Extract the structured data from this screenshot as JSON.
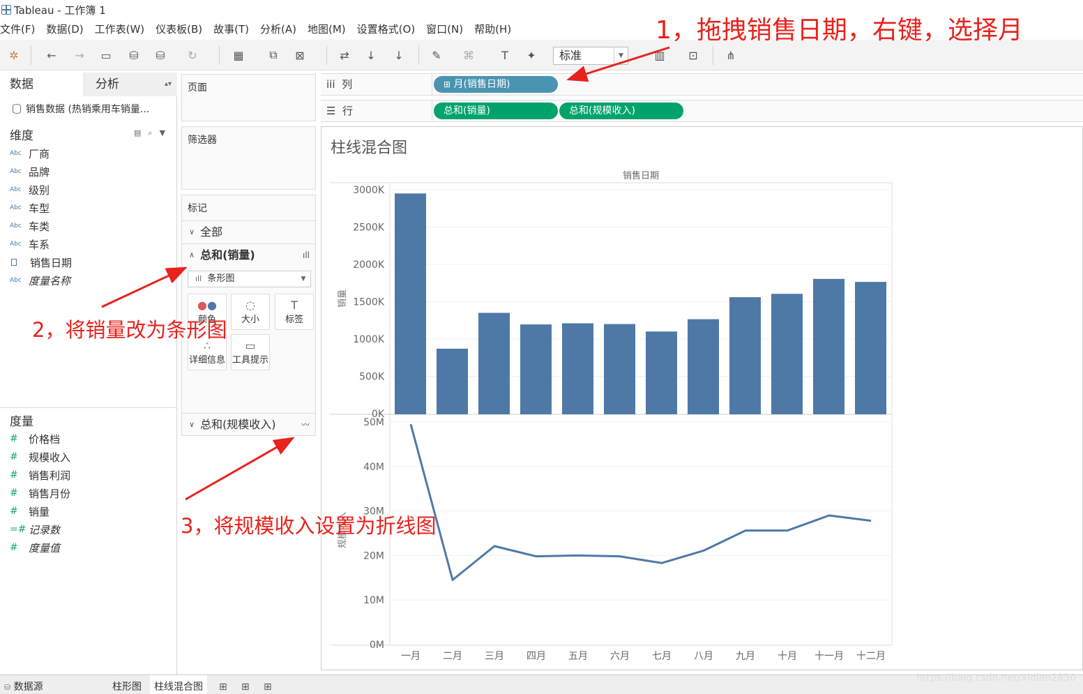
{
  "window": {
    "title": "Tableau - 工作簿 1"
  },
  "menu": [
    "文件(F)",
    "数据(D)",
    "工作表(W)",
    "仪表板(B)",
    "故事(T)",
    "分析(A)",
    "地图(M)",
    "设置格式(O)",
    "窗口(N)",
    "帮助(H)"
  ],
  "toolbar": {
    "fit_select": "标准"
  },
  "left_pane": {
    "tab_data": "数据",
    "tab_analysis": "分析",
    "datasource": "销售数据 (热销乘用车销量...",
    "dimensions_title": "维度",
    "dimensions": [
      {
        "label": "厂商",
        "icon": "Abc"
      },
      {
        "label": "品牌",
        "icon": "Abc"
      },
      {
        "label": "级别",
        "icon": "Abc"
      },
      {
        "label": "车型",
        "icon": "Abc"
      },
      {
        "label": "车类",
        "icon": "Abc"
      },
      {
        "label": "车系",
        "icon": "Abc"
      },
      {
        "label": "销售日期",
        "icon": "calendar-icon"
      },
      {
        "label": "度量名称",
        "icon": "Abc"
      }
    ],
    "measures_title": "度量",
    "measures": [
      {
        "label": "价格档",
        "icon": "#"
      },
      {
        "label": "规模收入",
        "icon": "#"
      },
      {
        "label": "销售利润",
        "icon": "#"
      },
      {
        "label": "销售月份",
        "icon": "#"
      },
      {
        "label": "销量",
        "icon": "#"
      },
      {
        "label": "记录数",
        "icon": "=#"
      },
      {
        "label": "度量值",
        "icon": "#"
      }
    ]
  },
  "cards": {
    "pages": "页面",
    "filters": "筛选器",
    "marks": "标记",
    "all": "全部",
    "sales_card": "总和(销量)",
    "mark_type": "条形图",
    "color": "颜色",
    "size": "大小",
    "label": "标签",
    "detail": "详细信息",
    "tooltip": "工具提示",
    "revenue_card": "总和(规模收入)"
  },
  "shelves": {
    "columns_label": "列",
    "rows_label": "行",
    "columns_pill": "月(销售日期)",
    "rows_pills": [
      "总和(销量)",
      "总和(规模收入)"
    ]
  },
  "bottom": {
    "datasource_tab": "数据源",
    "sheets": [
      "柱形图",
      "柱线混合图"
    ],
    "active_sheet": "柱线混合图",
    "watermark": "https://blog.csdn.net/Xidian2850"
  },
  "annotations": [
    "1，拖拽销售日期，右键，选择月",
    "2，将销量改为条形图",
    "3，将规模收入设置为折线图"
  ],
  "chart_data": {
    "type": "bar",
    "title": "柱线混合图",
    "header": "销售日期",
    "categories": [
      "一月",
      "二月",
      "三月",
      "四月",
      "五月",
      "六月",
      "七月",
      "八月",
      "九月",
      "十月",
      "十一月",
      "十二月"
    ],
    "panes": [
      {
        "type": "bar",
        "ylabel": "销量",
        "ylim": [
          0,
          3000000
        ],
        "yticks": [
          "0K",
          "500K",
          "1000K",
          "1500K",
          "2000K",
          "2500K",
          "3000K"
        ],
        "color": "#4e79a7",
        "values": [
          2950000,
          870000,
          1350000,
          1195000,
          1210000,
          1200000,
          1100000,
          1265000,
          1560000,
          1605000,
          1805000,
          1765000
        ]
      },
      {
        "type": "line",
        "ylabel": "规模收入",
        "ylim": [
          0,
          50000000
        ],
        "yticks": [
          "0M",
          "10M",
          "20M",
          "30M",
          "40M",
          "50M"
        ],
        "color": "#4e79a7",
        "values": [
          49500000,
          14500000,
          22100000,
          19800000,
          20000000,
          19800000,
          18300000,
          21100000,
          25600000,
          25600000,
          29000000,
          27800000
        ]
      }
    ],
    "grid": true
  }
}
